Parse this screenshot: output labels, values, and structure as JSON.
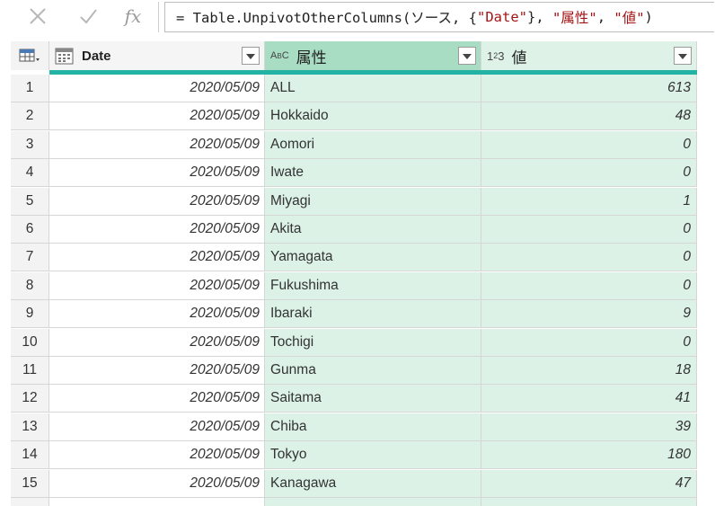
{
  "formula_bar": {
    "cancel_icon": "x-icon",
    "confirm_icon": "check-icon",
    "fx_label": "fx",
    "formula_prefix": "= Table.UnpivotOtherColumns(ソース, {",
    "formula_arg1": "\"Date\"",
    "formula_mid1": "}, ",
    "formula_arg2": "\"属性\"",
    "formula_mid2": ", ",
    "formula_arg3": "\"値\"",
    "formula_suffix": ")"
  },
  "columns": [
    {
      "name": "Date",
      "type_icon": "calendar-icon"
    },
    {
      "name": "属性",
      "type_icon": "text-type-icon",
      "type_label": "ABC"
    },
    {
      "name": "値",
      "type_icon": "number-type-icon",
      "type_label": "123"
    }
  ],
  "rows": [
    {
      "n": "1",
      "date": "2020/05/09",
      "attr": "ALL",
      "value": "613"
    },
    {
      "n": "2",
      "date": "2020/05/09",
      "attr": "Hokkaido",
      "value": "48"
    },
    {
      "n": "3",
      "date": "2020/05/09",
      "attr": "Aomori",
      "value": "0"
    },
    {
      "n": "4",
      "date": "2020/05/09",
      "attr": "Iwate",
      "value": "0"
    },
    {
      "n": "5",
      "date": "2020/05/09",
      "attr": "Miyagi",
      "value": "1"
    },
    {
      "n": "6",
      "date": "2020/05/09",
      "attr": "Akita",
      "value": "0"
    },
    {
      "n": "7",
      "date": "2020/05/09",
      "attr": "Yamagata",
      "value": "0"
    },
    {
      "n": "8",
      "date": "2020/05/09",
      "attr": "Fukushima",
      "value": "0"
    },
    {
      "n": "9",
      "date": "2020/05/09",
      "attr": "Ibaraki",
      "value": "9"
    },
    {
      "n": "10",
      "date": "2020/05/09",
      "attr": "Tochigi",
      "value": "0"
    },
    {
      "n": "11",
      "date": "2020/05/09",
      "attr": "Gunma",
      "value": "18"
    },
    {
      "n": "12",
      "date": "2020/05/09",
      "attr": "Saitama",
      "value": "41"
    },
    {
      "n": "13",
      "date": "2020/05/09",
      "attr": "Chiba",
      "value": "39"
    },
    {
      "n": "14",
      "date": "2020/05/09",
      "attr": "Tokyo",
      "value": "180"
    },
    {
      "n": "15",
      "date": "2020/05/09",
      "attr": "Kanagawa",
      "value": "47"
    },
    {
      "n": "",
      "date": "",
      "attr": "",
      "value": ""
    }
  ],
  "colors": {
    "selected_column_header": "#a8dcc3",
    "selected_column_body": "#dcf2e7",
    "quality_bar": "#22b3a4"
  }
}
